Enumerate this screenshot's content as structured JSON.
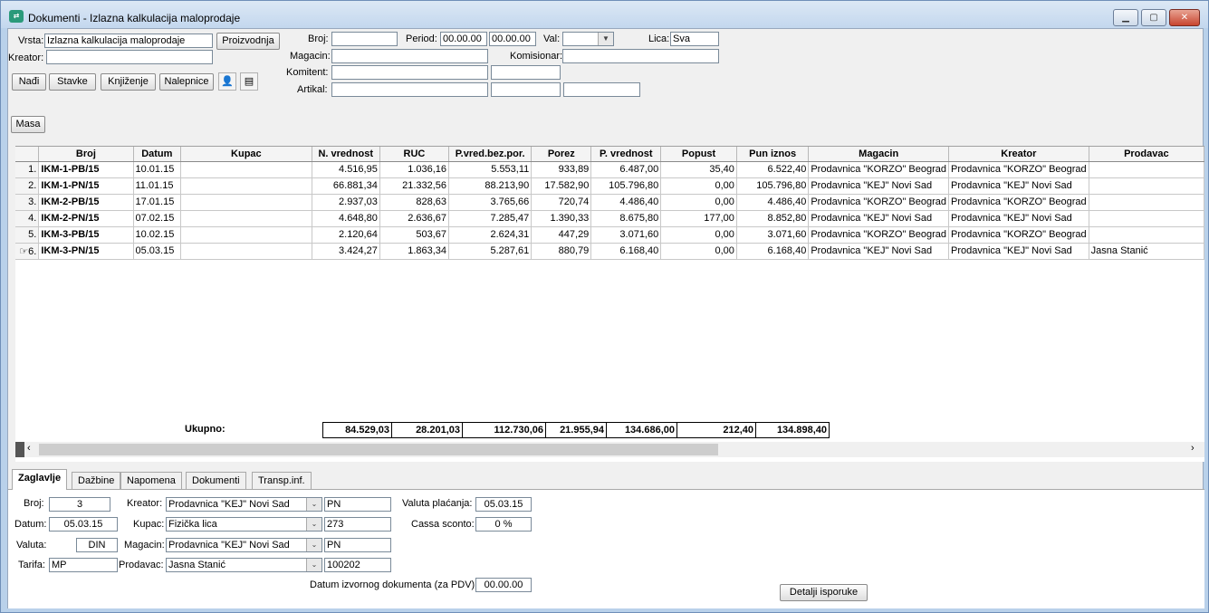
{
  "window": {
    "title": "Dokumenti - Izlazna kalkulacija maloprodaje",
    "app_icon": "sync-icon"
  },
  "filters": {
    "vrsta_label": "Vrsta:",
    "vrsta_value": "Izlazna kalkulacija maloprodaje",
    "proizvodnja_label": "Proizvodnja",
    "kreator_label": "Kreator:",
    "kreator_value": "",
    "broj_label": "Broj:",
    "broj_value": "",
    "period_label": "Period:",
    "period_from": "00.00.00",
    "period_to": "00.00.00",
    "val_label": "Val:",
    "val_value": "",
    "lica_label": "Lica:",
    "lica_value": "Sva",
    "magacin_label": "Magacin:",
    "magacin_value": "",
    "komisionar_label": "Komisionar:",
    "komisionar_value": "",
    "komitent_label": "Komitent:",
    "komitent_value": "",
    "komitent_value2": "",
    "artikal_label": "Artikal:",
    "artikal_value": "",
    "artikal_value2": "",
    "artikal_value3": ""
  },
  "toolbar": {
    "nadji": "Nađi",
    "stavke": "Stavke",
    "knjizenje": "Knjiženje",
    "nalepnice": "Nalepnice",
    "masa": "Masa"
  },
  "grid": {
    "columns": [
      "Broj",
      "Datum",
      "Kupac",
      "N. vrednost",
      "RUC",
      "P.vred.bez.por.",
      "Porez",
      "P. vrednost",
      "Popust",
      "Pun iznos",
      "Magacin",
      "Kreator",
      "Prodavac"
    ],
    "rows": [
      {
        "rn": "1.",
        "broj": "IKM-1-PB/15",
        "datum": "10.01.15",
        "kupac": "",
        "nvr": "4.516,95",
        "ruc": "1.036,16",
        "pvbp": "5.553,11",
        "porez": "933,89",
        "pvr": "6.487,00",
        "popust": "35,40",
        "pun": "6.522,40",
        "magacin": "Prodavnica \"KORZO\" Beograd",
        "kreator": "Prodavnica \"KORZO\" Beograd",
        "prodavac": ""
      },
      {
        "rn": "2.",
        "broj": "IKM-1-PN/15",
        "datum": "11.01.15",
        "kupac": "",
        "nvr": "66.881,34",
        "ruc": "21.332,56",
        "pvbp": "88.213,90",
        "porez": "17.582,90",
        "pvr": "105.796,80",
        "popust": "0,00",
        "pun": "105.796,80",
        "magacin": "Prodavnica \"KEJ\" Novi Sad",
        "kreator": "Prodavnica \"KEJ\" Novi Sad",
        "prodavac": ""
      },
      {
        "rn": "3.",
        "broj": "IKM-2-PB/15",
        "datum": "17.01.15",
        "kupac": "",
        "nvr": "2.937,03",
        "ruc": "828,63",
        "pvbp": "3.765,66",
        "porez": "720,74",
        "pvr": "4.486,40",
        "popust": "0,00",
        "pun": "4.486,40",
        "magacin": "Prodavnica \"KORZO\" Beograd",
        "kreator": "Prodavnica \"KORZO\" Beograd",
        "prodavac": ""
      },
      {
        "rn": "4.",
        "broj": "IKM-2-PN/15",
        "datum": "07.02.15",
        "kupac": "",
        "nvr": "4.648,80",
        "ruc": "2.636,67",
        "pvbp": "7.285,47",
        "porez": "1.390,33",
        "pvr": "8.675,80",
        "popust": "177,00",
        "pun": "8.852,80",
        "magacin": "Prodavnica \"KEJ\" Novi Sad",
        "kreator": "Prodavnica \"KEJ\" Novi Sad",
        "prodavac": ""
      },
      {
        "rn": "5.",
        "broj": "IKM-3-PB/15",
        "datum": "10.02.15",
        "kupac": "",
        "nvr": "2.120,64",
        "ruc": "503,67",
        "pvbp": "2.624,31",
        "porez": "447,29",
        "pvr": "3.071,60",
        "popust": "0,00",
        "pun": "3.071,60",
        "magacin": "Prodavnica \"KORZO\" Beograd",
        "kreator": "Prodavnica \"KORZO\" Beograd",
        "prodavac": ""
      },
      {
        "rn": "6.",
        "broj": "IKM-3-PN/15",
        "datum": "05.03.15",
        "kupac": "",
        "nvr": "3.424,27",
        "ruc": "1.863,34",
        "pvbp": "5.287,61",
        "porez": "880,79",
        "pvr": "6.168,40",
        "popust": "0,00",
        "pun": "6.168,40",
        "magacin": "Prodavnica \"KEJ\" Novi Sad",
        "kreator": "Prodavnica \"KEJ\" Novi Sad",
        "prodavac": "Jasna Stanić"
      }
    ],
    "totals": {
      "label": "Ukupno:",
      "nvr": "84.529,03",
      "ruc": "28.201,03",
      "pvbp": "112.730,06",
      "porez": "21.955,94",
      "pvr": "134.686,00",
      "popust": "212,40",
      "pun": "134.898,40"
    }
  },
  "tabs": [
    "Zaglavlje",
    "Dažbine",
    "Napomena",
    "Dokumenti",
    "Transp.inf."
  ],
  "detail": {
    "broj_label": "Broj:",
    "broj": "3",
    "datum_label": "Datum:",
    "datum": "05.03.15",
    "valuta_label": "Valuta:",
    "valuta": "DIN",
    "tarifa_label": "Tarifa:",
    "tarifa": "MP",
    "kreator_label": "Kreator:",
    "kreator": "Prodavnica \"KEJ\" Novi Sad",
    "kreator_code": "PN",
    "kupac_label": "Kupac:",
    "kupac": "Fizička lica",
    "kupac_code": "273",
    "magacin_label": "Magacin:",
    "magacin": "Prodavnica \"KEJ\" Novi Sad",
    "magacin_code": "PN",
    "prodavac_label": "Prodavac:",
    "prodavac": "Jasna Stanić",
    "prodavac_code": "100202",
    "valuta_placanja_label": "Valuta plaćanja:",
    "valuta_placanja": "05.03.15",
    "cassa_label": "Cassa sconto:",
    "cassa": "0 %",
    "datum_izv_label": "Datum izvornog dokumenta (za PDV):",
    "datum_izv": "00.00.00",
    "detalji_button": "Detalji isporuke"
  }
}
